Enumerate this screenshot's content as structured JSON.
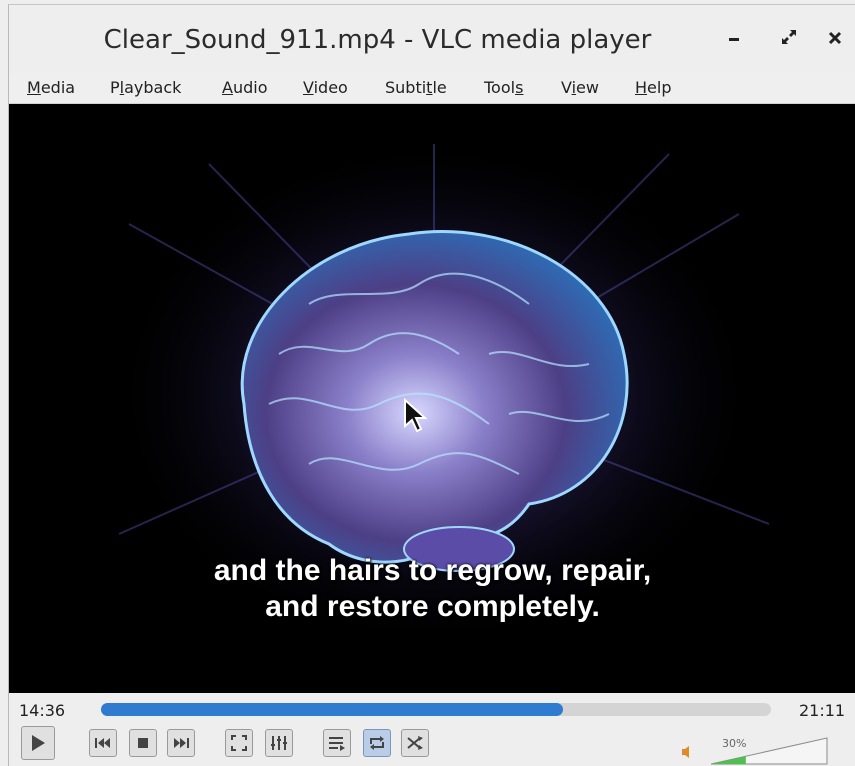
{
  "window": {
    "title": "Clear_Sound_911.mp4 - VLC media player"
  },
  "titlebar_buttons": [
    {
      "name": "minimize",
      "glyph": "–"
    },
    {
      "name": "maximize",
      "glyph": "⤢"
    },
    {
      "name": "close",
      "glyph": "×"
    }
  ],
  "menu": [
    {
      "pre": "",
      "u": "M",
      "post": "edia"
    },
    {
      "pre": "P",
      "u": "l",
      "post": "ayback"
    },
    {
      "pre": "",
      "u": "A",
      "post": "udio"
    },
    {
      "pre": "",
      "u": "V",
      "post": "ideo"
    },
    {
      "pre": "Subti",
      "u": "t",
      "post": "le"
    },
    {
      "pre": "Tool",
      "u": "s",
      "post": ""
    },
    {
      "pre": "V",
      "u": "i",
      "post": "ew"
    },
    {
      "pre": "",
      "u": "H",
      "post": "elp"
    }
  ],
  "video": {
    "subtitle_line1": "and the hairs to regrow, repair,",
    "subtitle_line2": "and restore completely."
  },
  "playback": {
    "current_time": "14:36",
    "total_time": "21:11",
    "progress": 0.69
  },
  "controls": [
    {
      "name": "play",
      "icon": "play-icon"
    },
    {
      "name": "previous",
      "icon": "previous-icon"
    },
    {
      "name": "stop",
      "icon": "stop-icon"
    },
    {
      "name": "next",
      "icon": "next-icon"
    },
    {
      "name": "fullscreen",
      "icon": "fullscreen-icon"
    },
    {
      "name": "extended-settings",
      "icon": "equalizer-icon"
    },
    {
      "name": "playlist",
      "icon": "playlist-icon"
    },
    {
      "name": "loop",
      "icon": "loop-icon",
      "active": true
    },
    {
      "name": "shuffle",
      "icon": "shuffle-icon"
    }
  ],
  "volume": {
    "label": "30%",
    "level": 0.3
  },
  "colors": {
    "accent": "#2f7bd0",
    "video_bg": "#000000",
    "brain_glow": "#7b8cff"
  }
}
